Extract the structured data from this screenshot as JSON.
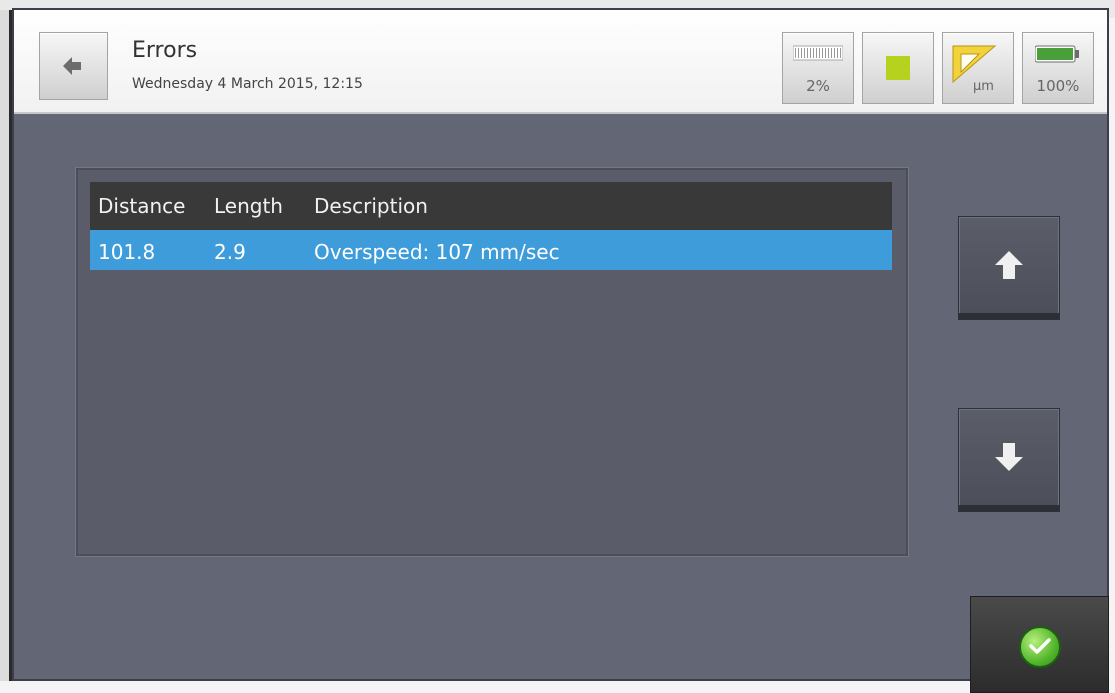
{
  "header": {
    "title": "Errors",
    "datetime": "Wednesday 4 March 2015, 12:15"
  },
  "status": {
    "progress_percent": 2,
    "progress_text": "2%",
    "unit_text": "µm",
    "battery_text": "100%",
    "battery_percent": 100,
    "indicator_color": "#b7d21e"
  },
  "table": {
    "columns": [
      "Distance",
      "Length",
      "Description"
    ],
    "rows": [
      {
        "distance": "101.8",
        "length": "2.9",
        "description": "Overspeed: 107 mm/sec"
      }
    ]
  },
  "nav": {
    "up_icon": "arrow-up-icon",
    "down_icon": "arrow-down-icon",
    "confirm_icon": "check-circle-icon"
  },
  "colors": {
    "selected_row": "#3e9cdb",
    "panel_bg": "#5a5c69",
    "frame_bg": "#636675"
  }
}
